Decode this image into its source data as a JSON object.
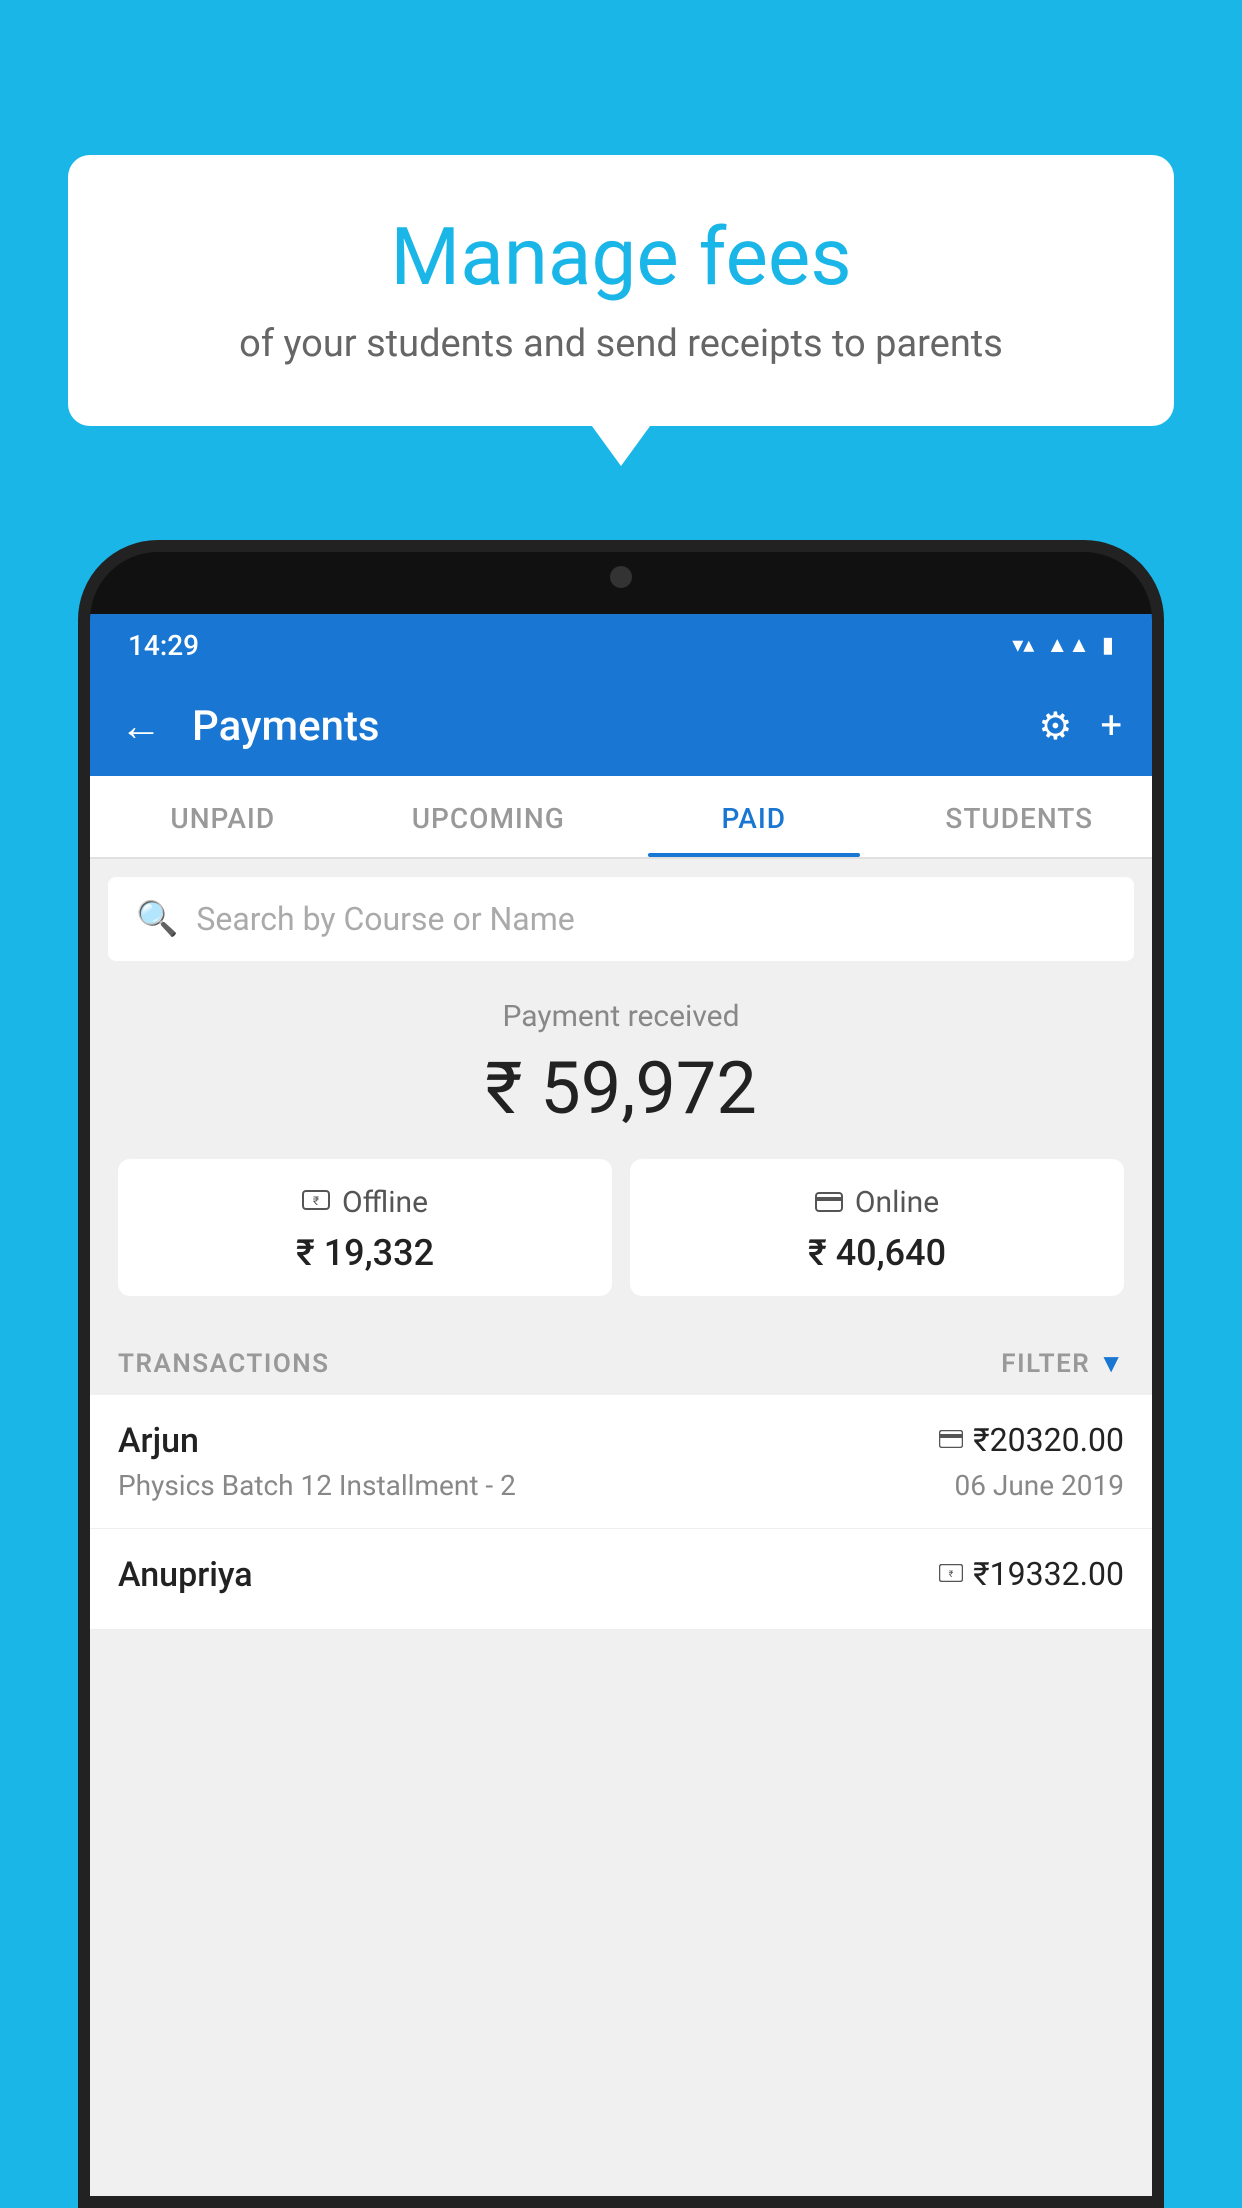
{
  "background_color": "#1ab6e8",
  "speech_bubble": {
    "title": "Manage fees",
    "subtitle": "of your students and send receipts to parents"
  },
  "status_bar": {
    "time": "14:29",
    "icons": [
      "wifi",
      "signal",
      "battery"
    ]
  },
  "app_bar": {
    "title": "Payments",
    "back_icon": "←",
    "settings_icon": "⚙",
    "add_icon": "+"
  },
  "tabs": [
    {
      "label": "UNPAID",
      "active": false
    },
    {
      "label": "UPCOMING",
      "active": false
    },
    {
      "label": "PAID",
      "active": true
    },
    {
      "label": "STUDENTS",
      "active": false
    }
  ],
  "search": {
    "placeholder": "Search by Course or Name"
  },
  "payment_summary": {
    "received_label": "Payment received",
    "total_amount": "₹ 59,972",
    "offline": {
      "label": "Offline",
      "amount": "₹ 19,332"
    },
    "online": {
      "label": "Online",
      "amount": "₹ 40,640"
    }
  },
  "transactions": {
    "section_label": "TRANSACTIONS",
    "filter_label": "FILTER",
    "items": [
      {
        "name": "Arjun",
        "course": "Physics Batch 12 Installment - 2",
        "amount": "₹20320.00",
        "date": "06 June 2019",
        "payment_type": "online"
      },
      {
        "name": "Anupriya",
        "course": "",
        "amount": "₹19332.00",
        "date": "",
        "payment_type": "offline"
      }
    ]
  }
}
